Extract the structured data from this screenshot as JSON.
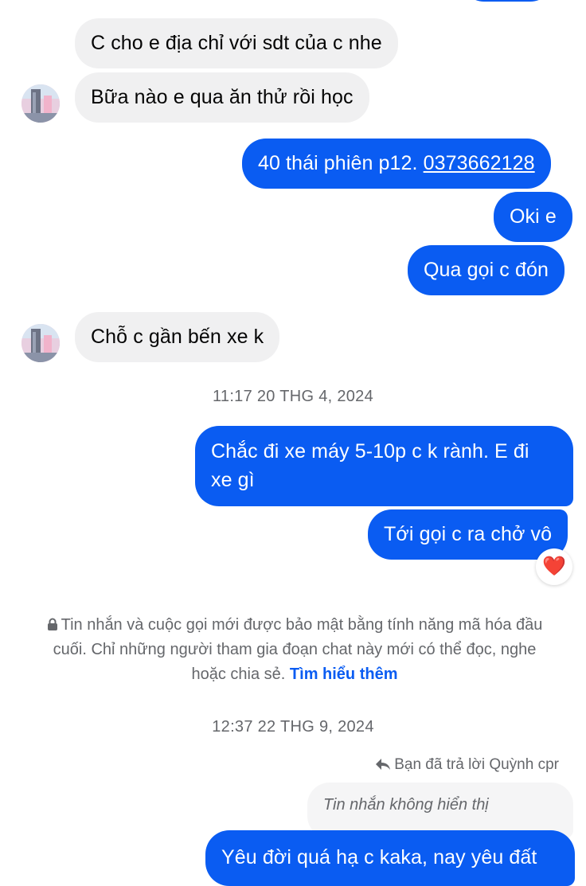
{
  "messages": [
    {
      "text": "C cho e địa chỉ với sdt của c nhe"
    },
    {
      "text": "Bữa nào e qua ăn thử rồi học"
    },
    {
      "text_prefix": "40 thái phiên p12. ",
      "phone": "0373662128"
    },
    {
      "text": "Oki e"
    },
    {
      "text": "Qua gọi c đón"
    },
    {
      "text": "Chỗ c gần bến xe k"
    },
    {
      "text_line1": "Chắc đi xe máy 5-10p c k rành. E đi",
      "text_line2": "xe gì"
    },
    {
      "text": "Tới gọi c ra chở vô",
      "reaction": "❤️"
    },
    {
      "text": "Yêu đời quá hạ c kaka, nay yêu đất"
    }
  ],
  "timestamps": {
    "first": "11:17 20 THG 4, 2024",
    "second": "12:37 22 THG 9, 2024"
  },
  "encryption_notice": {
    "line1": "Tin nhắn và cuộc gọi mới được bảo mật bằng tính năng mã hóa đầu",
    "line2": "cuối. Chỉ những người tham gia đoạn chat này mới có thể đọc, nghe",
    "line3": "hoặc chia sẻ. ",
    "link": "Tìm hiểu thêm"
  },
  "reply": {
    "header": "Bạn đã trả lời Quỳnh cpr",
    "quoted": "Tin nhắn không hiển thị"
  },
  "colors": {
    "outgoing": "#0a5cf2",
    "incoming": "#f0f0f1",
    "meta_text": "#65676b"
  }
}
